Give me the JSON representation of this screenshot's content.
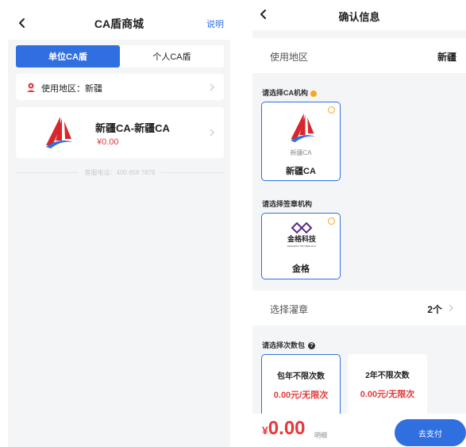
{
  "left": {
    "header": {
      "title": "CA盾商城",
      "help": "说明"
    },
    "tabs": [
      {
        "label": "单位CA盾",
        "active": true
      },
      {
        "label": "个人CA盾",
        "active": false
      }
    ],
    "region": {
      "text": "使用地区：新疆"
    },
    "product": {
      "name": "新疆CA-新疆CA",
      "price": "¥0.00"
    },
    "service_phone": "客服电话：400 658 7878"
  },
  "right": {
    "header": {
      "title": "确认信息"
    },
    "region": {
      "label": "使用地区",
      "value": "新疆"
    },
    "ca_section": {
      "label": "请选择CA机构"
    },
    "ca_org": {
      "small": "新疆CA",
      "name": "新疆CA"
    },
    "sign_section": {
      "label": "请选择签章机构"
    },
    "sign_org": {
      "logo_text": "金格科技",
      "logo_sub": "KINGGRID TECHNOLOGY",
      "name": "金格"
    },
    "seal": {
      "label": "选择濯章",
      "value": "2个"
    },
    "package_section": {
      "label": "请选择次数包"
    },
    "packages": [
      {
        "title": "包年不限次数",
        "price": "0.00元/无限次",
        "active": true
      },
      {
        "title": "2年不限次数",
        "price": "0.00元/无限次",
        "active": false
      }
    ],
    "pay": {
      "currency": "¥",
      "amount": "0.00",
      "detail": "明细",
      "button": "去支付"
    }
  },
  "colors": {
    "accent": "#2f6fe0",
    "price": "#e4393c",
    "warn": "#f5a623"
  },
  "icons": [
    "back-arrow-icon",
    "location-pin-icon",
    "chevron-right-icon",
    "info-icon",
    "help-icon"
  ]
}
